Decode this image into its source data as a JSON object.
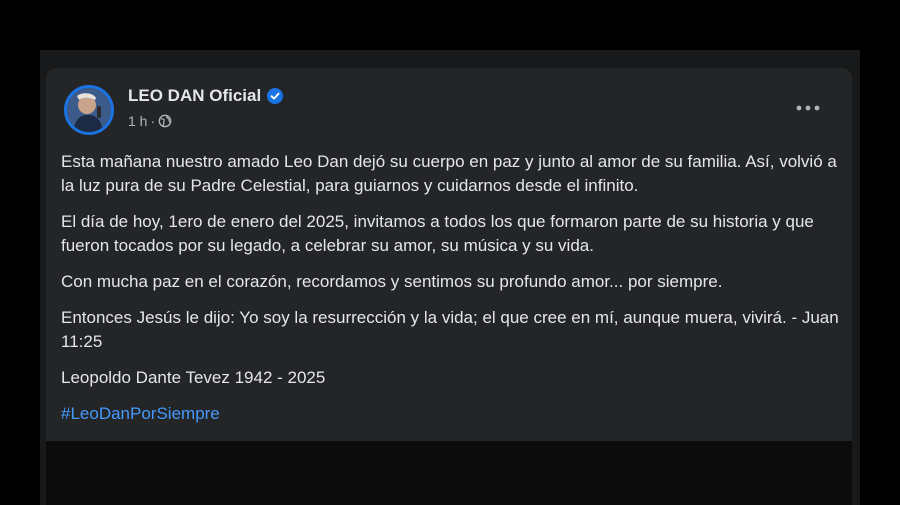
{
  "post": {
    "author": "LEO DAN Oficial",
    "timestamp": "1 h",
    "separator": "·",
    "verified_icon": "verified-badge-icon",
    "audience_icon": "globe-icon",
    "more_icon": "more-options-icon",
    "accent_color": "#1b74e4",
    "hashtag_color": "#4599ff",
    "paragraphs": [
      "Esta mañana nuestro amado Leo Dan dejó su cuerpo en paz y junto al amor de su familia. Así, volvió a la luz pura de su Padre Celestial, para guiarnos y cuidarnos desde el infinito.",
      "El día de hoy, 1ero de enero del 2025, invitamos a todos los que formaron parte de su historia y que fueron tocados por su legado, a celebrar su amor, su música y su vida.",
      "Con mucha paz en el corazón, recordamos y sentimos su profundo amor... por siempre.",
      "Entonces Jesús le dijo: Yo soy la resurrección y la vida; el que cree en mí, aunque muera, vivirá. - Juan 11:25",
      "Leopoldo Dante Tevez 1942 - 2025"
    ],
    "hashtag": "#LeoDanPorSiempre"
  }
}
